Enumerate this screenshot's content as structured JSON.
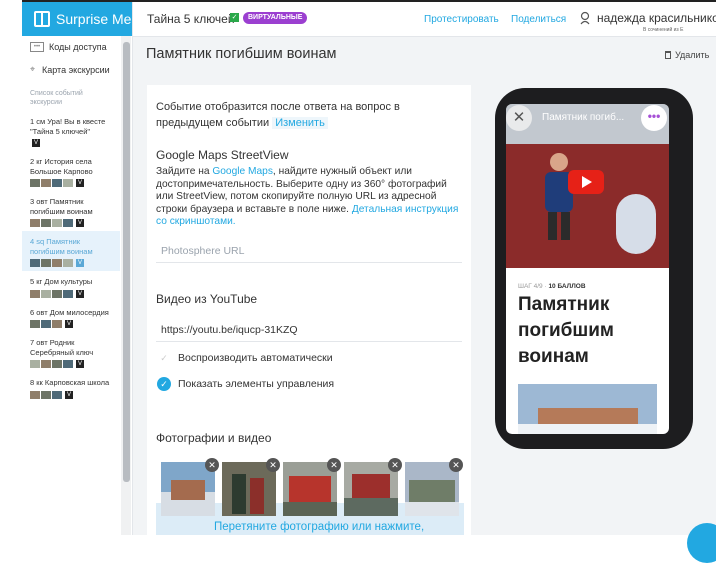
{
  "brand": {
    "name": "Surprise Me",
    "icon": "gift-icon"
  },
  "sidebar": {
    "links": [
      {
        "label": "Коды доступа",
        "icon": "codes-icon"
      },
      {
        "label": "Карта экскурсии",
        "icon": "map-pin-icon"
      }
    ],
    "caption": "Список событий экскурсии",
    "events": [
      {
        "label": "1 см Ура! Вы в квесте \"Тайна 5 ключей\"",
        "badge": "V",
        "active": false
      },
      {
        "label": "2 кг История села Большое Карпово",
        "badge": "V",
        "active": false
      },
      {
        "label": "3 овт Памятник погибшим воинам",
        "badge": "V",
        "active": false
      },
      {
        "label": "4 sq Памятник погибшим воинам",
        "badge": "V",
        "active": true
      },
      {
        "label": "5 кг Дом культуры",
        "badge": "V",
        "active": false
      },
      {
        "label": "6 овт Дом милосердия",
        "badge": "V",
        "active": false
      },
      {
        "label": "7 овт Родник Серебряный ключ",
        "badge": "V",
        "active": false
      },
      {
        "label": "8 кк Карповская школа",
        "badge": "V",
        "active": false
      }
    ]
  },
  "header": {
    "title": "Тайна 5 ключей",
    "check": "✓",
    "pill": "ВИРТУАЛЬНЫЕ",
    "test": "Протестировать",
    "share": "Поделиться",
    "user": "надежда красильникова",
    "user_sub": "В сочинений из Е"
  },
  "main": {
    "title": "Памятник погибшим воинам",
    "delete": "Удалить",
    "condition": "Событие отобразится после ответа на вопрос в предыдущем событии",
    "condition_change": "Изменить",
    "gmaps": {
      "title": "Google Maps StreetView",
      "desc_1": "Зайдите на ",
      "desc_link": "Google Maps",
      "desc_2": ", найдите нужный объект или достопримечательность. Выберите одну из 360° фотографий или StreetView, потом скопируйте полную URL из адресной строки браузера и вставьте в поле ниже. ",
      "desc_link2": "Детальная инструкция со скриншотами.",
      "placeholder": "Photosphere URL"
    },
    "youtube": {
      "title": "Видео из YouTube",
      "value": "https://youtu.be/iqucp-31KZQ",
      "autoplay": {
        "label": "Воспроизводить автоматически",
        "checked": false
      },
      "controls": {
        "label": "Показать элементы управления",
        "checked": true
      }
    },
    "photos": {
      "title": "Фотографии и видео",
      "drop_text": "Перетяните фотографию или нажмите,"
    }
  },
  "preview": {
    "video_title": "Памятник погиб...",
    "step": "ШАГ 4/9 ·",
    "points": "10 БАЛЛОВ",
    "title": "Памятник погибшим воинам"
  }
}
